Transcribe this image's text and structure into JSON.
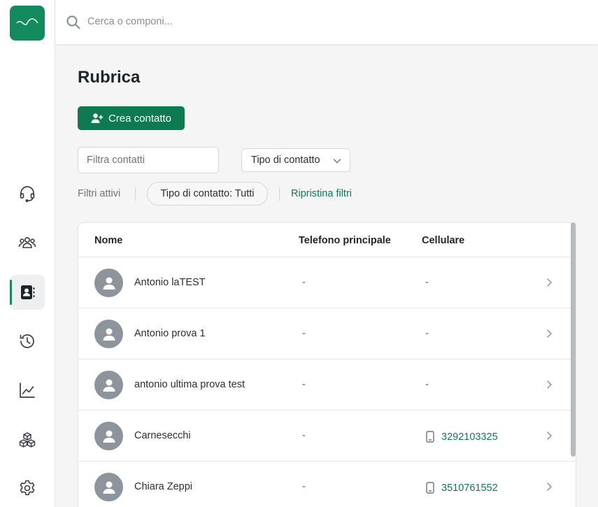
{
  "search": {
    "placeholder": "Cerca o componi..."
  },
  "sidebar": {
    "logo": "wave-logo",
    "items": [
      {
        "icon": "headset-icon",
        "active": false
      },
      {
        "icon": "group-icon",
        "active": false
      },
      {
        "icon": "contacts-book-icon",
        "active": true
      },
      {
        "icon": "history-icon",
        "active": false
      },
      {
        "icon": "chart-icon",
        "active": false
      },
      {
        "icon": "cubes-icon",
        "active": false
      },
      {
        "icon": "gear-icon",
        "active": false
      }
    ]
  },
  "page": {
    "title": "Rubrica",
    "create_label": "Crea contatto",
    "filter_placeholder": "Filtra contatti",
    "type_select_label": "Tipo di contatto",
    "active_filters_label": "Filtri attivi",
    "chip_label": "Tipo di contatto: Tutti",
    "reset_label": "Ripristina filtri"
  },
  "table": {
    "columns": {
      "name": "Nome",
      "phone": "Telefono principale",
      "mobile": "Cellulare"
    },
    "rows": [
      {
        "name": "Antonio laTEST",
        "phone": "-",
        "mobile": "-"
      },
      {
        "name": "Antonio prova 1",
        "phone": "-",
        "mobile": "-"
      },
      {
        "name": "antonio ultima prova test",
        "phone": "-",
        "mobile": "-"
      },
      {
        "name": "Carnesecchi",
        "phone": "-",
        "mobile": "3292103325"
      },
      {
        "name": "Chiara Zeppi",
        "phone": "-",
        "mobile": "3510761552"
      }
    ]
  },
  "colors": {
    "brand": "#148b5f",
    "button": "#0e7a52",
    "link": "#0e7a52"
  }
}
